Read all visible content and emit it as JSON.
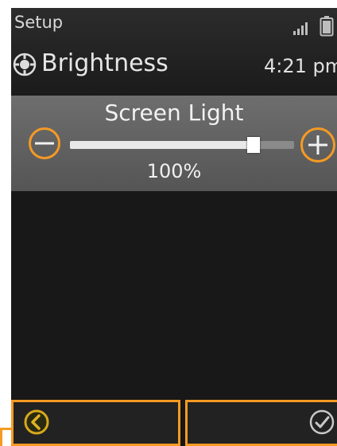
{
  "statusbar": {
    "app_title": "Setup",
    "signal_icon": "signal-bars-icon",
    "battery_icon": "battery-icon"
  },
  "header": {
    "screen_icon": "brightness-icon",
    "title": "Brightness",
    "clock": "4:21 pm"
  },
  "setting": {
    "label": "Screen Light",
    "value_text": "100%",
    "level_percent": 100,
    "decrease_icon": "minus-icon",
    "increase_icon": "plus-icon"
  },
  "softkeys": {
    "left_icon": "back-arrow-icon",
    "right_icon": "checkmark-icon"
  },
  "colors": {
    "accent": "#f59a23",
    "background": "#161616",
    "panel": "#626262"
  }
}
